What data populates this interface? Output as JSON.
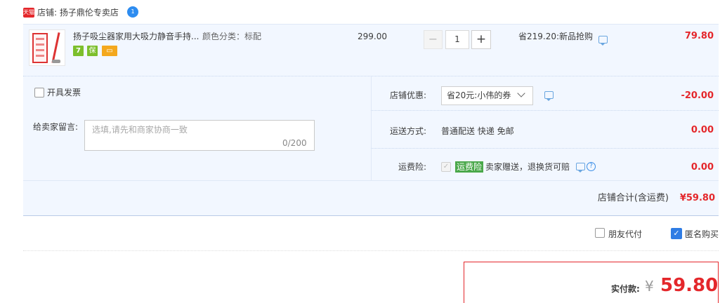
{
  "shop": {
    "logo_text": "天猫",
    "name": "店铺: 扬子鼎伦专卖店",
    "ww_icon_text": "1"
  },
  "item": {
    "title": "扬子吸尘器家用大吸力静音手持...",
    "spec": "颜色分类：标配",
    "price": "299.00",
    "quantity": "1",
    "qty_minus": "−",
    "qty_plus": "+",
    "promo": "省219.20:新品抢购",
    "line_total": "79.80",
    "badge_7": "7",
    "badge_safe": "保",
    "badge_card": "▭"
  },
  "invoice": {
    "label": "开具发票"
  },
  "message": {
    "label": "给卖家留言:",
    "placeholder": "选填,请先和商家协商一致",
    "counter": "0/200"
  },
  "shop_discount": {
    "label": "店铺优惠:",
    "selected": "省20元:小伟的券",
    "amount": "-20.00"
  },
  "shipping": {
    "label": "运送方式:",
    "method": "普通配送 快递 免邮",
    "amount": "0.00"
  },
  "freight_insurance": {
    "label": "运费险:",
    "tag": "运费险",
    "description": "卖家赠送，退换货可赔",
    "amount": "0.00"
  },
  "shop_total": {
    "label": "店铺合计(含运费)",
    "amount": "¥59.80"
  },
  "options": {
    "friend_pay": "朋友代付",
    "anonymous": "匿名购买",
    "friend_pay_checked": false,
    "anonymous_checked": true
  },
  "payment": {
    "label": "实付款:",
    "currency": "¥",
    "amount": "59.80"
  },
  "colors": {
    "accent_red": "#e4272b",
    "row_background": "#f2f7ff",
    "checkbox_blue": "#2f7ce4",
    "insurance_green": "#4aa84a"
  }
}
